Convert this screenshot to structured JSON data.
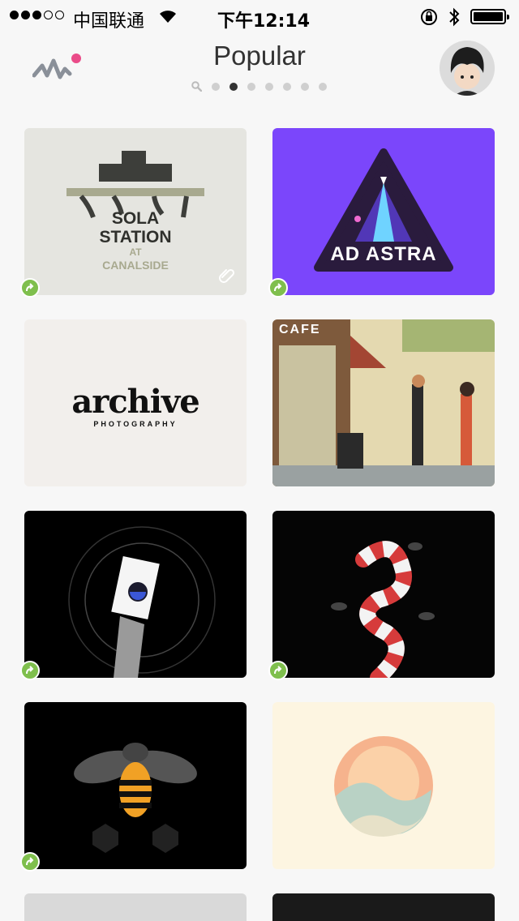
{
  "status_bar": {
    "carrier": "中国联通",
    "time": "下午12:14"
  },
  "header": {
    "title": "Popular",
    "page_indicator": {
      "total_dots": 7,
      "active_index": 2
    }
  },
  "shots": [
    {
      "name": "sola-station",
      "lines": [
        "SOLA",
        "STATION",
        "AT",
        "CANALSIDE"
      ],
      "has_rebound": true,
      "has_attachment": true
    },
    {
      "name": "ad-astra",
      "lines": [
        "AD ASTRA"
      ],
      "has_rebound": true
    },
    {
      "name": "archive",
      "lines": [
        "archive",
        "PHOTOGRAPHY"
      ],
      "has_rebound": false
    },
    {
      "name": "cafe-illustration",
      "lines": [
        "CAFE"
      ],
      "has_rebound": false
    },
    {
      "name": "hand-card",
      "lines": [],
      "has_rebound": true
    },
    {
      "name": "snake",
      "lines": [],
      "has_rebound": true
    },
    {
      "name": "bee",
      "lines": [],
      "has_rebound": true
    },
    {
      "name": "sunrise-logo",
      "lines": [],
      "has_rebound": false
    }
  ],
  "colors": {
    "accent_pink": "#ea4c89",
    "rebound_green": "#7fbf4d",
    "ad_astra_purple": "#7b46fb"
  }
}
